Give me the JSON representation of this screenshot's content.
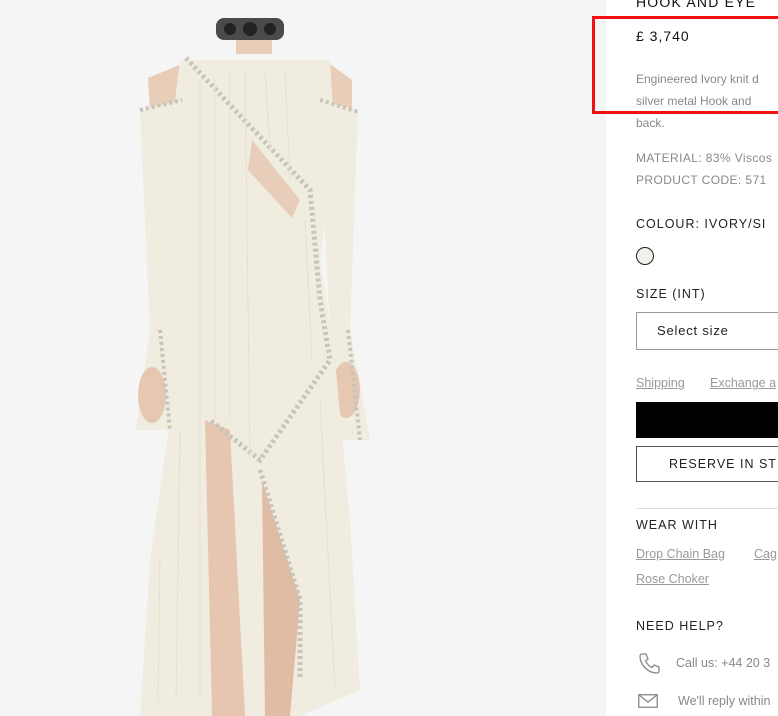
{
  "product": {
    "title": "HOOK AND EYE",
    "price": "£ 3,740",
    "description_lines": [
      "Engineered Ivory knit d",
      "silver metal Hook and",
      "back."
    ],
    "material": "MATERIAL: 83% Viscos",
    "product_code": "PRODUCT CODE:  571"
  },
  "colour": {
    "label": "COLOUR: IVORY/SI",
    "swatch_color": "#f1f0ec"
  },
  "size": {
    "label": "SIZE  (INT)",
    "select_value": "Select size"
  },
  "links": {
    "shipping": "Shipping",
    "exchange": "Exchange a"
  },
  "buttons": {
    "add_to_bag": "",
    "reserve": "RESERVE IN ST"
  },
  "wear_with": {
    "heading": "WEAR WITH",
    "items": [
      "Drop Chain Bag",
      "Cag",
      "Rose Choker"
    ]
  },
  "help": {
    "heading": "NEED HELP?",
    "call": "Call us: +44 20 3",
    "email": "We'll reply within"
  },
  "colors": {
    "highlight": "#f01010",
    "button_black": "#000000",
    "image_background": "#f5f5f5"
  },
  "icons": [
    "phone-icon",
    "envelope-icon"
  ]
}
